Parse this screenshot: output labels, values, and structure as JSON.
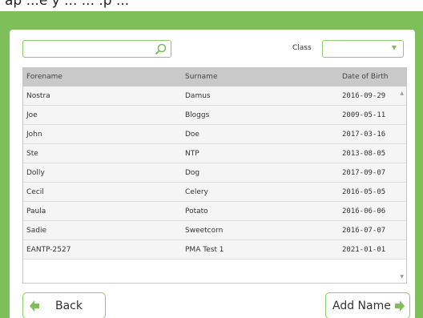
{
  "header": {
    "text": "ap ...e y ... ... .p ..."
  },
  "search": {
    "placeholder": "",
    "value": ""
  },
  "class_filter": {
    "label": "Class",
    "selected": ""
  },
  "table": {
    "columns": [
      "Forename",
      "Surname",
      "Date of Birth"
    ],
    "rows": [
      [
        "Nostra",
        "Damus",
        "2016-09-29"
      ],
      [
        "Joe",
        "Bloggs",
        "2009-05-11"
      ],
      [
        "John",
        "Doe",
        "2017-03-16"
      ],
      [
        "Ste",
        "NTP",
        "2013-08-05"
      ],
      [
        "Dolly",
        "Dog",
        "2017-09-07"
      ],
      [
        "Cecil",
        "Celery",
        "2016-05-05"
      ],
      [
        "Paula",
        "Potato",
        "2016-06-06"
      ],
      [
        "Sadie",
        "Sweetcorn",
        "2016-07-07"
      ],
      [
        "EANTP-2527",
        "PMA Test 1",
        "2021-01-01"
      ]
    ]
  },
  "buttons": {
    "back": "Back",
    "add": "Add Name"
  },
  "colors": {
    "accent": "#7fbf5a",
    "header_bg": "#c9c9c9",
    "border": "#8cc96a"
  },
  "icons": {
    "search": "magnifier-icon",
    "back": "arrow-left-icon",
    "add": "arrow-right-icon"
  }
}
